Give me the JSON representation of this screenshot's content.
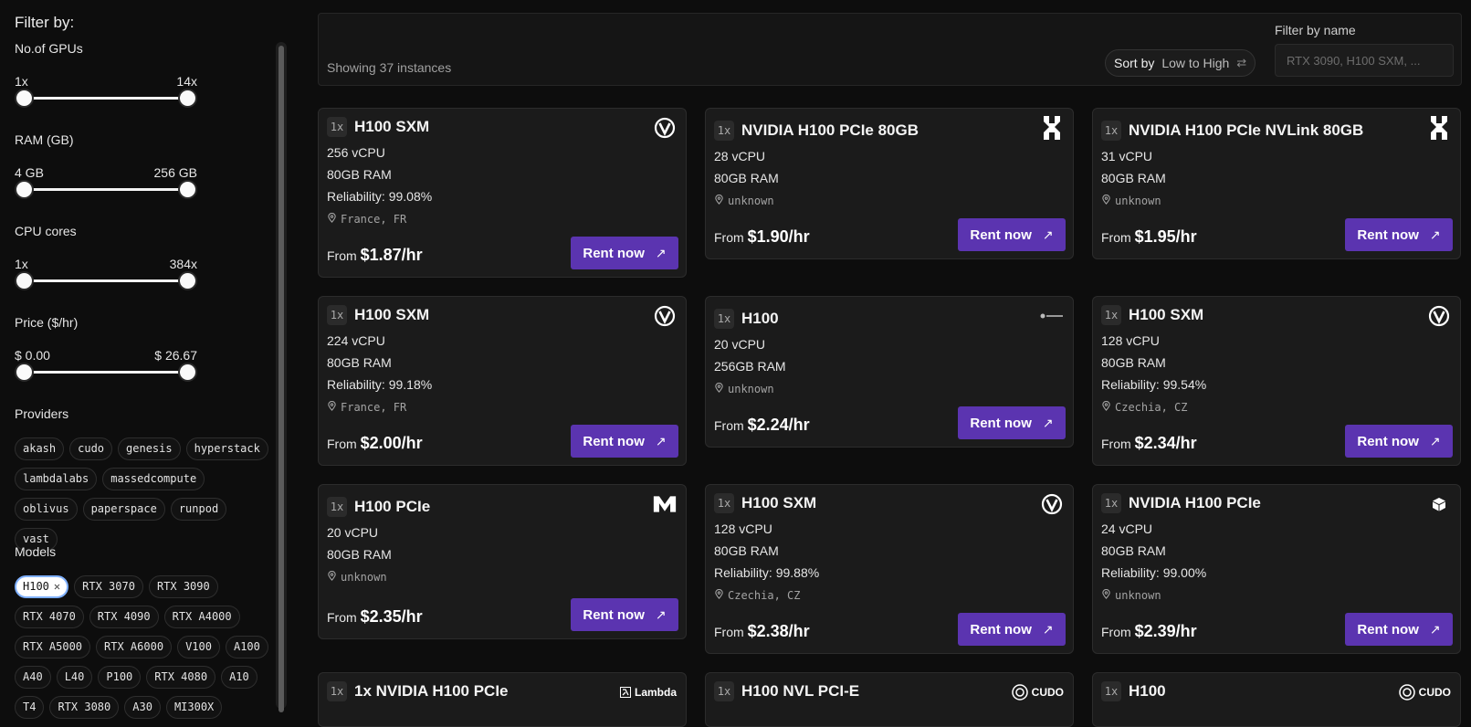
{
  "filters": {
    "title": "Filter by:",
    "gpus": {
      "label": "No.of GPUs",
      "min": "1x",
      "max": "14x"
    },
    "ram": {
      "label": "RAM (GB)",
      "min": "4 GB",
      "max": "256 GB"
    },
    "cpu": {
      "label": "CPU cores",
      "min": "1x",
      "max": "384x"
    },
    "price": {
      "label": "Price ($/hr)",
      "min": "$ 0.00",
      "max": "$ 26.67"
    },
    "providers": {
      "label": "Providers",
      "items": [
        "akash",
        "cudo",
        "genesis",
        "hyperstack",
        "lambdalabs",
        "massedcompute",
        "oblivus",
        "paperspace",
        "runpod",
        "vast"
      ]
    },
    "models": {
      "label": "Models",
      "selected": "H100",
      "items": [
        "RTX 3070",
        "RTX 3090",
        "RTX 4070",
        "RTX 4090",
        "RTX A4000",
        "RTX A5000",
        "RTX A6000",
        "V100",
        "A100",
        "A40",
        "L40",
        "P100",
        "RTX 4080",
        "A10",
        "T4",
        "RTX 3080",
        "A30",
        "MI300X"
      ]
    }
  },
  "toolbar": {
    "showing": "Showing 37 instances",
    "sort_key": "Sort by",
    "sort_value": "Low to High",
    "filter_name_label": "Filter by name",
    "filter_name_placeholder": "RTX 3090, H100 SXM, ..."
  },
  "cards": [
    {
      "count": "1x",
      "name": "H100 SXM",
      "provider_icon": "v-shield-logo-icon",
      "vcpu": "256 vCPU",
      "ram": "80GB RAM",
      "reliability": "Reliability: 99.08%",
      "location": "France, FR",
      "from": "From",
      "price": "$1.87/hr",
      "cta": "Rent now"
    },
    {
      "count": "1x",
      "name": "NVIDIA H100 PCIe 80GB",
      "provider_icon": "hyperstack-logo-icon",
      "vcpu": "28 vCPU",
      "ram": "80GB RAM",
      "location": "unknown",
      "from": "From",
      "price": "$1.90/hr",
      "cta": "Rent now"
    },
    {
      "count": "1x",
      "name": "NVIDIA H100 PCIe NVLink 80GB",
      "provider_icon": "hyperstack-logo-icon",
      "vcpu": "31 vCPU",
      "ram": "80GB RAM",
      "location": "unknown",
      "from": "From",
      "price": "$1.95/hr",
      "cta": "Rent now"
    },
    {
      "count": "1x",
      "name": "H100 SXM",
      "provider_icon": "v-shield-logo-icon",
      "vcpu": "224 vCPU",
      "ram": "80GB RAM",
      "reliability": "Reliability: 99.18%",
      "location": "France, FR",
      "from": "From",
      "price": "$2.00/hr",
      "cta": "Rent now"
    },
    {
      "count": "1x",
      "name": "H100",
      "provider_icon": "small-wordmark-logo-icon",
      "vcpu": "20 vCPU",
      "ram": "256GB RAM",
      "location": "unknown",
      "from": "From",
      "price": "$2.24/hr",
      "cta": "Rent now"
    },
    {
      "count": "1x",
      "name": "H100 SXM",
      "provider_icon": "v-shield-logo-icon",
      "vcpu": "128 vCPU",
      "ram": "80GB RAM",
      "reliability": "Reliability: 99.54%",
      "location": "Czechia, CZ",
      "from": "From",
      "price": "$2.34/hr",
      "cta": "Rent now"
    },
    {
      "count": "1x",
      "name": "H100 PCIe",
      "provider_icon": "m-logo-icon",
      "vcpu": "20 vCPU",
      "ram": "80GB RAM",
      "location": "unknown",
      "from": "From",
      "price": "$2.35/hr",
      "cta": "Rent now"
    },
    {
      "count": "1x",
      "name": "H100 SXM",
      "provider_icon": "v-shield-logo-icon",
      "vcpu": "128 vCPU",
      "ram": "80GB RAM",
      "reliability": "Reliability: 99.88%",
      "location": "Czechia, CZ",
      "from": "From",
      "price": "$2.38/hr",
      "cta": "Rent now"
    },
    {
      "count": "1x",
      "name": "NVIDIA H100 PCIe",
      "provider_icon": "cube-logo-icon",
      "vcpu": "24 vCPU",
      "ram": "80GB RAM",
      "reliability": "Reliability: 99.00%",
      "location": "unknown",
      "from": "From",
      "price": "$2.39/hr",
      "cta": "Rent now"
    },
    {
      "count": "1x",
      "name": "1x NVIDIA H100 PCIe",
      "provider_icon": "lambda-logo-icon",
      "provider_wordmark": "Lambda"
    },
    {
      "count": "1x",
      "name": "H100 NVL PCI-E",
      "provider_icon": "cudo-logo-icon",
      "provider_wordmark": "CUDO"
    },
    {
      "count": "1x",
      "name": "H100",
      "provider_icon": "cudo-logo-icon",
      "provider_wordmark": "CUDO"
    }
  ]
}
